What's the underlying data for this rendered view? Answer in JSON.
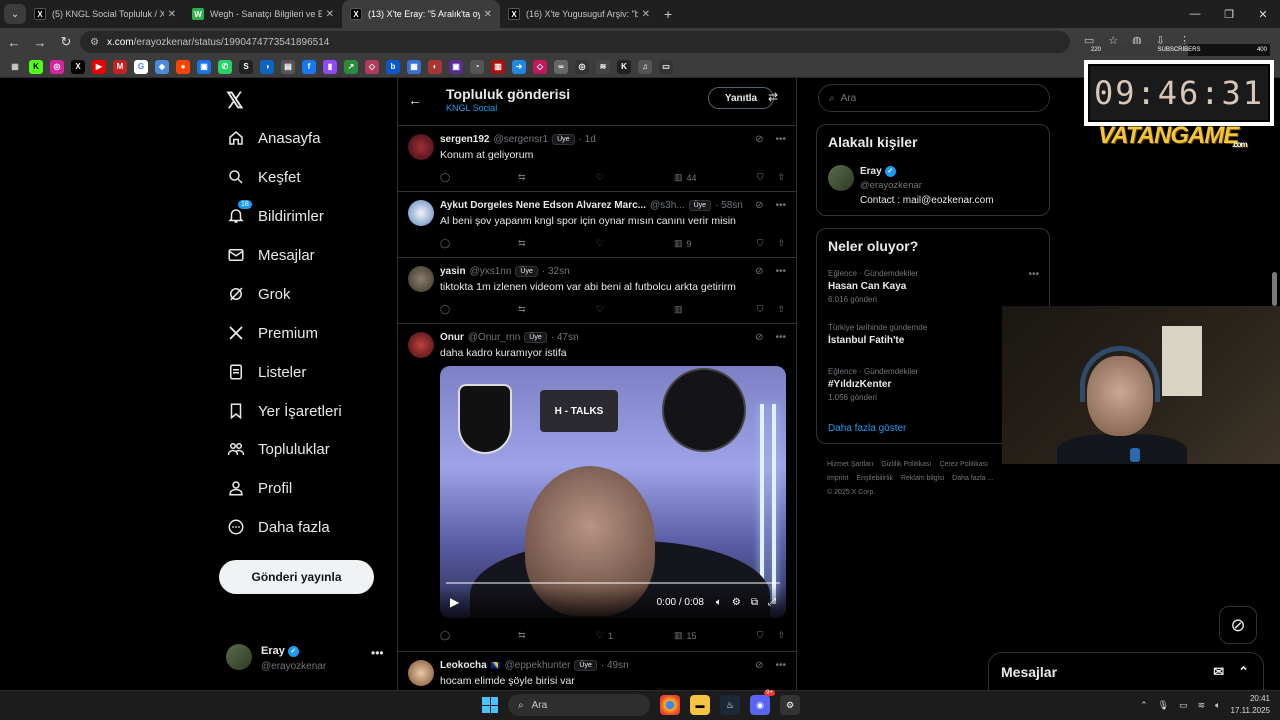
{
  "browser": {
    "tabs": [
      {
        "title": "(5) KNGL Social Topluluk / X",
        "favicon": "x",
        "active": false
      },
      {
        "title": "Wegh - Sanatçı Bilgileri ve Etkin",
        "favicon": "w",
        "active": false
      },
      {
        "title": "(13) X'te Eray: \"5 Aralık'ta oyna",
        "favicon": "x",
        "active": true
      },
      {
        "title": "(16) X'te Yugusuguf Arşiv: \"bu h",
        "favicon": "x",
        "active": false
      }
    ],
    "url_domain": "x.com",
    "url_path": "/erayozkenar/status/1990474773541896514"
  },
  "nav": {
    "items": [
      {
        "label": "Anasayfa",
        "icon": "home-icon"
      },
      {
        "label": "Keşfet",
        "icon": "search-icon"
      },
      {
        "label": "Bildirimler",
        "icon": "bell-icon",
        "badge": "18"
      },
      {
        "label": "Mesajlar",
        "icon": "mail-icon"
      },
      {
        "label": "Grok",
        "icon": "grok-icon"
      },
      {
        "label": "Premium",
        "icon": "x-icon"
      },
      {
        "label": "Listeler",
        "icon": "list-icon"
      },
      {
        "label": "Yer İşaretleri",
        "icon": "bookmark-icon"
      },
      {
        "label": "Topluluklar",
        "icon": "communities-icon"
      },
      {
        "label": "Profil",
        "icon": "person-icon"
      },
      {
        "label": "Daha fazla",
        "icon": "more-icon"
      }
    ],
    "post_button": "Gönderi yayınla",
    "account": {
      "name": "Eray",
      "handle": "@erayozkenar"
    }
  },
  "thread": {
    "title": "Topluluk gönderisi",
    "community": "KNGL Social",
    "reply_button": "Yanıtla",
    "posts": [
      {
        "name": "sergen192",
        "handle": "@sergensr1",
        "role": "Üye",
        "time": "1d",
        "text": "Konum at geliyorum",
        "likes": "",
        "views": "44"
      },
      {
        "name": "Aykut Dorgeles Nene Edson Alvarez Marc...",
        "handle": "@s3h...",
        "role": "Üye",
        "time": "58sn",
        "text": "Al beni şov yapanm kngl spor için oynar mısın canını verir misin",
        "likes": "",
        "views": "9"
      },
      {
        "name": "yasin",
        "handle": "@yxs1nn",
        "role": "Üye",
        "time": "32sn",
        "text": "tiktokta 1m izlenen videom var abi beni al futbolcu arkta getirirm",
        "likes": "",
        "views": ""
      },
      {
        "name": "Onur",
        "handle": "@Onur_rnn",
        "role": "Üye",
        "time": "47sn",
        "text": "daha kadro kuramıyor istifa",
        "likes": "1",
        "views": "15",
        "video": {
          "time": "0:00 / 0:08",
          "sign": "H - TALKS",
          "progress": 0
        }
      },
      {
        "name": "Leokocha",
        "handle": "@eppekhunter",
        "role": "Üye",
        "time": "49sn",
        "text": "hocam elimde şöyle birisi var",
        "likes": "",
        "views": ""
      }
    ]
  },
  "sidebar": {
    "search_placeholder": "Ara",
    "related": {
      "title": "Alakalı kişiler",
      "name": "Eray",
      "handle": "@erayozkenar",
      "bio": "Contact : mail@eozkenar.com"
    },
    "trends": {
      "title": "Neler oluyor?",
      "items": [
        {
          "category": "Eğlence · Gündemdekiler",
          "name": "Hasan Can Kaya",
          "count": "6.016 gönderi"
        },
        {
          "category": "Türkiye tarihinde gündemde",
          "name": "İstanbul Fatih'te",
          "count": ""
        },
        {
          "category": "Eğlence · Gündemdekiler",
          "name": "#YıldızKenter",
          "count": "1.056 gönderi"
        }
      ],
      "show_more": "Daha fazla göster"
    },
    "footer": [
      "Hizmet Şartları",
      "Gizlilik Politikası",
      "Çerez Politikası",
      "Imprint",
      "Erişilebilirlik",
      "Reklam bilgisi",
      "Daha fazla ...",
      "© 2025 X Corp."
    ]
  },
  "overlay": {
    "subs_left": "220",
    "subs_label": "SUBSCRIBERS",
    "subs_right": "400",
    "subs_progress": 0.55,
    "clock": "09:46:31",
    "logo": "VATANGAME",
    "logo_suffix": ".com"
  },
  "messages_drawer": {
    "title": "Mesajlar"
  },
  "taskbar": {
    "search": "Ara",
    "time": "20:41",
    "date": "17.11.2025",
    "discord_badge": "9+"
  },
  "colors": {
    "accent": "#1d9bf0",
    "background": "#000000",
    "border": "#2f3336"
  }
}
